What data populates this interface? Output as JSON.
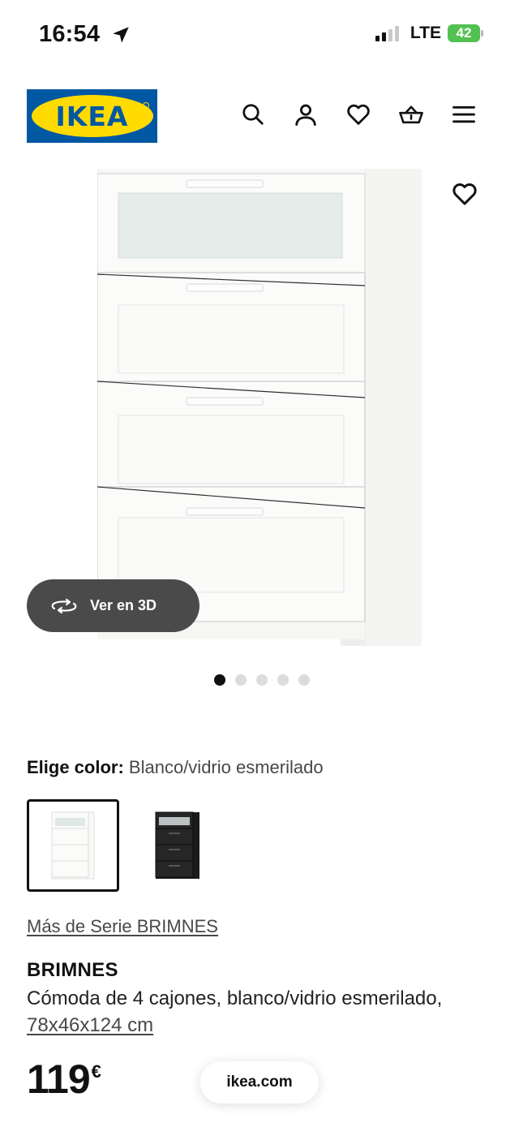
{
  "status_bar": {
    "time": "16:54",
    "network": "LTE",
    "battery": "42"
  },
  "header": {
    "logo_text": "IKEA",
    "icons": [
      "search-icon",
      "user-icon",
      "heart-icon",
      "basket-icon",
      "menu-icon"
    ]
  },
  "gallery": {
    "view_3d_label": "Ver en 3D",
    "dots_count": 5,
    "active_dot": 1
  },
  "color": {
    "label": "Elige color:",
    "value": "Blanco/vidrio esmerilado",
    "options": [
      "white",
      "black"
    ],
    "selected": 0
  },
  "serie_link": "Más de Serie BRIMNES",
  "product": {
    "name": "BRIMNES",
    "description": "Cómoda de 4 cajones, blanco/vidrio esmerilado,",
    "dimensions": "78x46x124 cm",
    "price": "119",
    "currency": "€"
  },
  "browser": {
    "url": "ikea.com"
  },
  "colors": {
    "ikea_blue": "#0058a3",
    "ikea_yellow": "#ffdb00",
    "battery_green": "#52c152"
  }
}
